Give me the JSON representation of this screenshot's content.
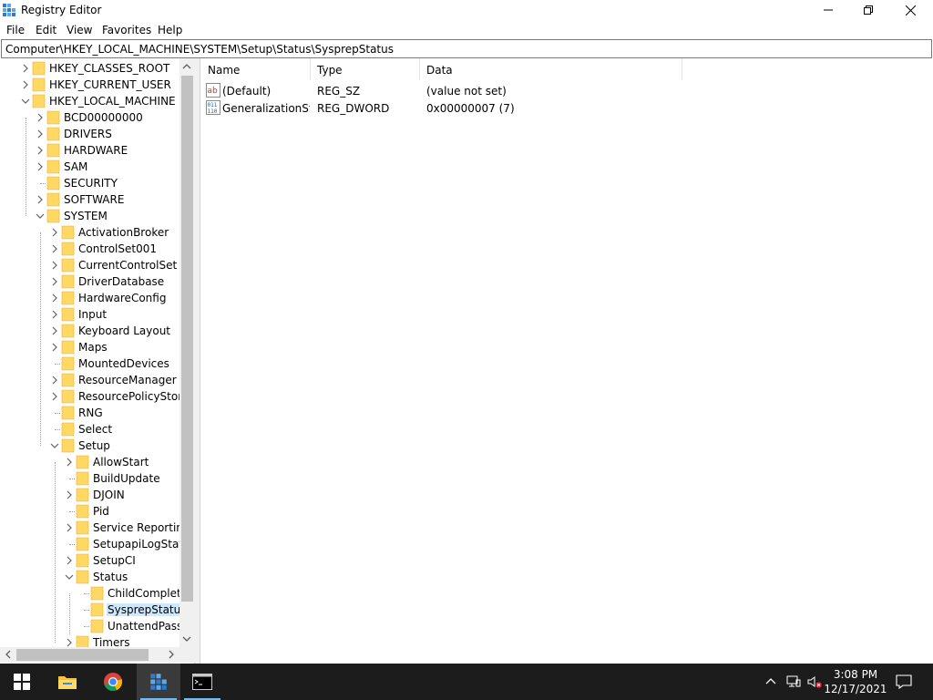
{
  "window": {
    "title": "Registry Editor",
    "icon": "regedit-icon",
    "controls": [
      "minimize-icon",
      "restore-icon",
      "close-icon"
    ]
  },
  "menu": {
    "items": [
      "File",
      "Edit",
      "View",
      "Favorites",
      "Help"
    ]
  },
  "address": {
    "path": "Computer\\HKEY_LOCAL_MACHINE\\SYSTEM\\Setup\\Status\\SysprepStatus"
  },
  "tree": {
    "items": [
      {
        "label": "HKEY_CLASSES_ROOT",
        "level": 1,
        "expander": "collapsed"
      },
      {
        "label": "HKEY_CURRENT_USER",
        "level": 1,
        "expander": "collapsed"
      },
      {
        "label": "HKEY_LOCAL_MACHINE",
        "level": 1,
        "expander": "expanded"
      },
      {
        "label": "BCD00000000",
        "level": 2,
        "expander": "collapsed"
      },
      {
        "label": "DRIVERS",
        "level": 2,
        "expander": "collapsed"
      },
      {
        "label": "HARDWARE",
        "level": 2,
        "expander": "collapsed"
      },
      {
        "label": "SAM",
        "level": 2,
        "expander": "collapsed"
      },
      {
        "label": "SECURITY",
        "level": 2,
        "expander": "none"
      },
      {
        "label": "SOFTWARE",
        "level": 2,
        "expander": "collapsed"
      },
      {
        "label": "SYSTEM",
        "level": 2,
        "expander": "expanded"
      },
      {
        "label": "ActivationBroker",
        "level": 3,
        "expander": "collapsed"
      },
      {
        "label": "ControlSet001",
        "level": 3,
        "expander": "collapsed"
      },
      {
        "label": "CurrentControlSet",
        "level": 3,
        "expander": "collapsed"
      },
      {
        "label": "DriverDatabase",
        "level": 3,
        "expander": "collapsed"
      },
      {
        "label": "HardwareConfig",
        "level": 3,
        "expander": "collapsed"
      },
      {
        "label": "Input",
        "level": 3,
        "expander": "collapsed"
      },
      {
        "label": "Keyboard Layout",
        "level": 3,
        "expander": "collapsed"
      },
      {
        "label": "Maps",
        "level": 3,
        "expander": "collapsed"
      },
      {
        "label": "MountedDevices",
        "level": 3,
        "expander": "none"
      },
      {
        "label": "ResourceManager",
        "level": 3,
        "expander": "collapsed"
      },
      {
        "label": "ResourcePolicyStore",
        "level": 3,
        "expander": "collapsed"
      },
      {
        "label": "RNG",
        "level": 3,
        "expander": "none"
      },
      {
        "label": "Select",
        "level": 3,
        "expander": "none"
      },
      {
        "label": "Setup",
        "level": 3,
        "expander": "expanded"
      },
      {
        "label": "AllowStart",
        "level": 4,
        "expander": "collapsed"
      },
      {
        "label": "BuildUpdate",
        "level": 4,
        "expander": "none"
      },
      {
        "label": "DJOIN",
        "level": 4,
        "expander": "collapsed"
      },
      {
        "label": "Pid",
        "level": 4,
        "expander": "none"
      },
      {
        "label": "Service Reporting",
        "level": 4,
        "expander": "collapsed"
      },
      {
        "label": "SetupapiLogStatu",
        "level": 4,
        "expander": "none"
      },
      {
        "label": "SetupCI",
        "level": 4,
        "expander": "collapsed"
      },
      {
        "label": "Status",
        "level": 4,
        "expander": "expanded"
      },
      {
        "label": "ChildComplet",
        "level": 5,
        "expander": "none"
      },
      {
        "label": "SysprepStatus",
        "level": 5,
        "expander": "none",
        "selected": true
      },
      {
        "label": "UnattendPasse",
        "level": 5,
        "expander": "none"
      },
      {
        "label": "Timers",
        "level": 4,
        "expander": "collapsed"
      }
    ]
  },
  "list": {
    "columns": [
      "Name",
      "Type",
      "Data"
    ],
    "rows": [
      {
        "icon": "string-value-icon",
        "name": "(Default)",
        "type": "REG_SZ",
        "data": "(value not set)"
      },
      {
        "icon": "binary-value-icon",
        "name": "GeneralizationSt...",
        "type": "REG_DWORD",
        "data": "0x00000007 (7)"
      }
    ]
  },
  "taskbar": {
    "apps": [
      "start-icon",
      "file-explorer-icon",
      "chrome-icon",
      "regedit-icon",
      "command-prompt-icon"
    ],
    "active_app": "regedit-icon",
    "tray": [
      "show-hidden-icons-icon",
      "network-icon",
      "volume-muted-icon",
      "notifications-icon"
    ],
    "time": "3:08 PM",
    "date": "12/17/2021"
  },
  "colors": {
    "selection": "#cce8ff",
    "taskbar": "#1c1c1c",
    "folder": "#ffd866",
    "accent": "#76b9ed"
  }
}
